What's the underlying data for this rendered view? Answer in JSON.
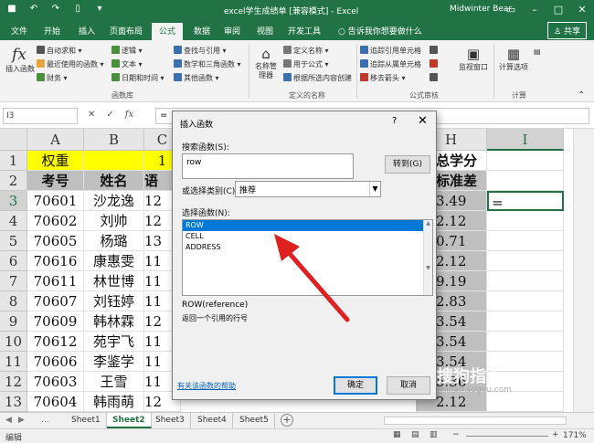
{
  "window": {
    "title": "excel学生成绩单 [兼容模式] - Excel",
    "user": "Midwinter Bear",
    "colors": {
      "brand": "#217346",
      "accent": "#0078d7",
      "arrow": "#e02020"
    }
  },
  "tabs": [
    "文件",
    "开始",
    "插入",
    "页面布局",
    "公式",
    "数据",
    "审阅",
    "视图",
    "开发工具"
  ],
  "active_tab": "公式",
  "tellme": "告诉我你想要做什么",
  "share": "共享",
  "ribbon": {
    "insert_function": "插入函数",
    "fx": "fx",
    "lib_col1": [
      "自动求和 ▾",
      "最近使用的函数 ▾",
      "财务 ▾"
    ],
    "lib_col2": [
      "逻辑 ▾",
      "文本 ▾",
      "日期和时间 ▾"
    ],
    "lib_col3": [
      "查找与引用 ▾",
      "数学和三角函数 ▾",
      "其他函数 ▾"
    ],
    "group_library": "函数库",
    "name_manager": "名称管理器",
    "names": [
      "定义名称 ▾",
      "用于公式 ▾",
      "根据所选内容创建"
    ],
    "group_names": "定义的名称",
    "audit_col1": [
      "追踪引用单元格",
      "追踪从属单元格",
      "移去箭头 ▾"
    ],
    "audit_col2": [
      "显示公式",
      "错误检查 ▾",
      "公式求值"
    ],
    "group_audit": "公式审核",
    "watch_window": "监视窗口",
    "calc_options": "计算选项",
    "group_calc": "计算"
  },
  "formula_bar": {
    "name_box": "I3",
    "cancel": "✕",
    "enter": "✓",
    "fx": "fx",
    "content": "="
  },
  "grid": {
    "columns": [
      "A",
      "B",
      "C",
      "H",
      "I"
    ],
    "rows": [
      "1",
      "2",
      "3",
      "4",
      "5",
      "6",
      "7",
      "8",
      "9",
      "10",
      "11",
      "12",
      "13"
    ],
    "row1": {
      "A": "权重",
      "C": "1",
      "H": "总学分"
    },
    "row2": {
      "A": "考号",
      "B": "姓名",
      "C": "语",
      "H": "标准差"
    },
    "data": [
      {
        "A": "70601",
        "B": "沙龙逸",
        "C": "12",
        "H": "3.49",
        "I": "="
      },
      {
        "A": "70602",
        "B": "刘帅",
        "C": "12",
        "H": "2.12",
        "I": ""
      },
      {
        "A": "70605",
        "B": "杨璐",
        "C": "13",
        "H": "0.71",
        "I": ""
      },
      {
        "A": "70616",
        "B": "康惠雯",
        "C": "11",
        "H": "2.12",
        "I": ""
      },
      {
        "A": "70611",
        "B": "林世博",
        "C": "11",
        "H": "9.19",
        "I": ""
      },
      {
        "A": "70607",
        "B": "刘钰婷",
        "C": "11",
        "H": "2.83",
        "I": ""
      },
      {
        "A": "70609",
        "B": "韩林霖",
        "C": "12",
        "H": "3.54",
        "I": ""
      },
      {
        "A": "70612",
        "B": "苑宇飞",
        "C": "11",
        "H": "3.54",
        "I": ""
      },
      {
        "A": "70606",
        "B": "李鉴学",
        "C": "11",
        "H": "3.54",
        "I": ""
      },
      {
        "A": "70603",
        "B": "王雪",
        "C": "11",
        "H": "5.36",
        "I": ""
      },
      {
        "A": "70604",
        "B": "韩雨萌",
        "C": "12",
        "H": "2.12",
        "I": ""
      }
    ]
  },
  "sheets": [
    "Sheet1",
    "Sheet2",
    "Sheet3",
    "Sheet4",
    "Sheet5"
  ],
  "active_sheet": "Sheet2",
  "status": {
    "mode": "编辑",
    "zoom": "171%"
  },
  "dialog": {
    "title": "插入函数",
    "help": "?",
    "close": "✕",
    "search_label": "搜索函数(S):",
    "search_value": "row",
    "go_button": "转到(G)",
    "category_label": "或选择类别(C):",
    "category_value": "推荐",
    "select_label": "选择函数(N):",
    "functions": [
      "ROW",
      "CELL",
      "ADDRESS"
    ],
    "selected_function": "ROW",
    "signature": "ROW(reference)",
    "description": "返回一个引用的行号",
    "help_link": "有关该函数的帮助",
    "ok_button": "确定",
    "cancel_button": "取消"
  },
  "watermark": {
    "text": "搜狗指南",
    "url": "zhinan.sogou.com"
  }
}
